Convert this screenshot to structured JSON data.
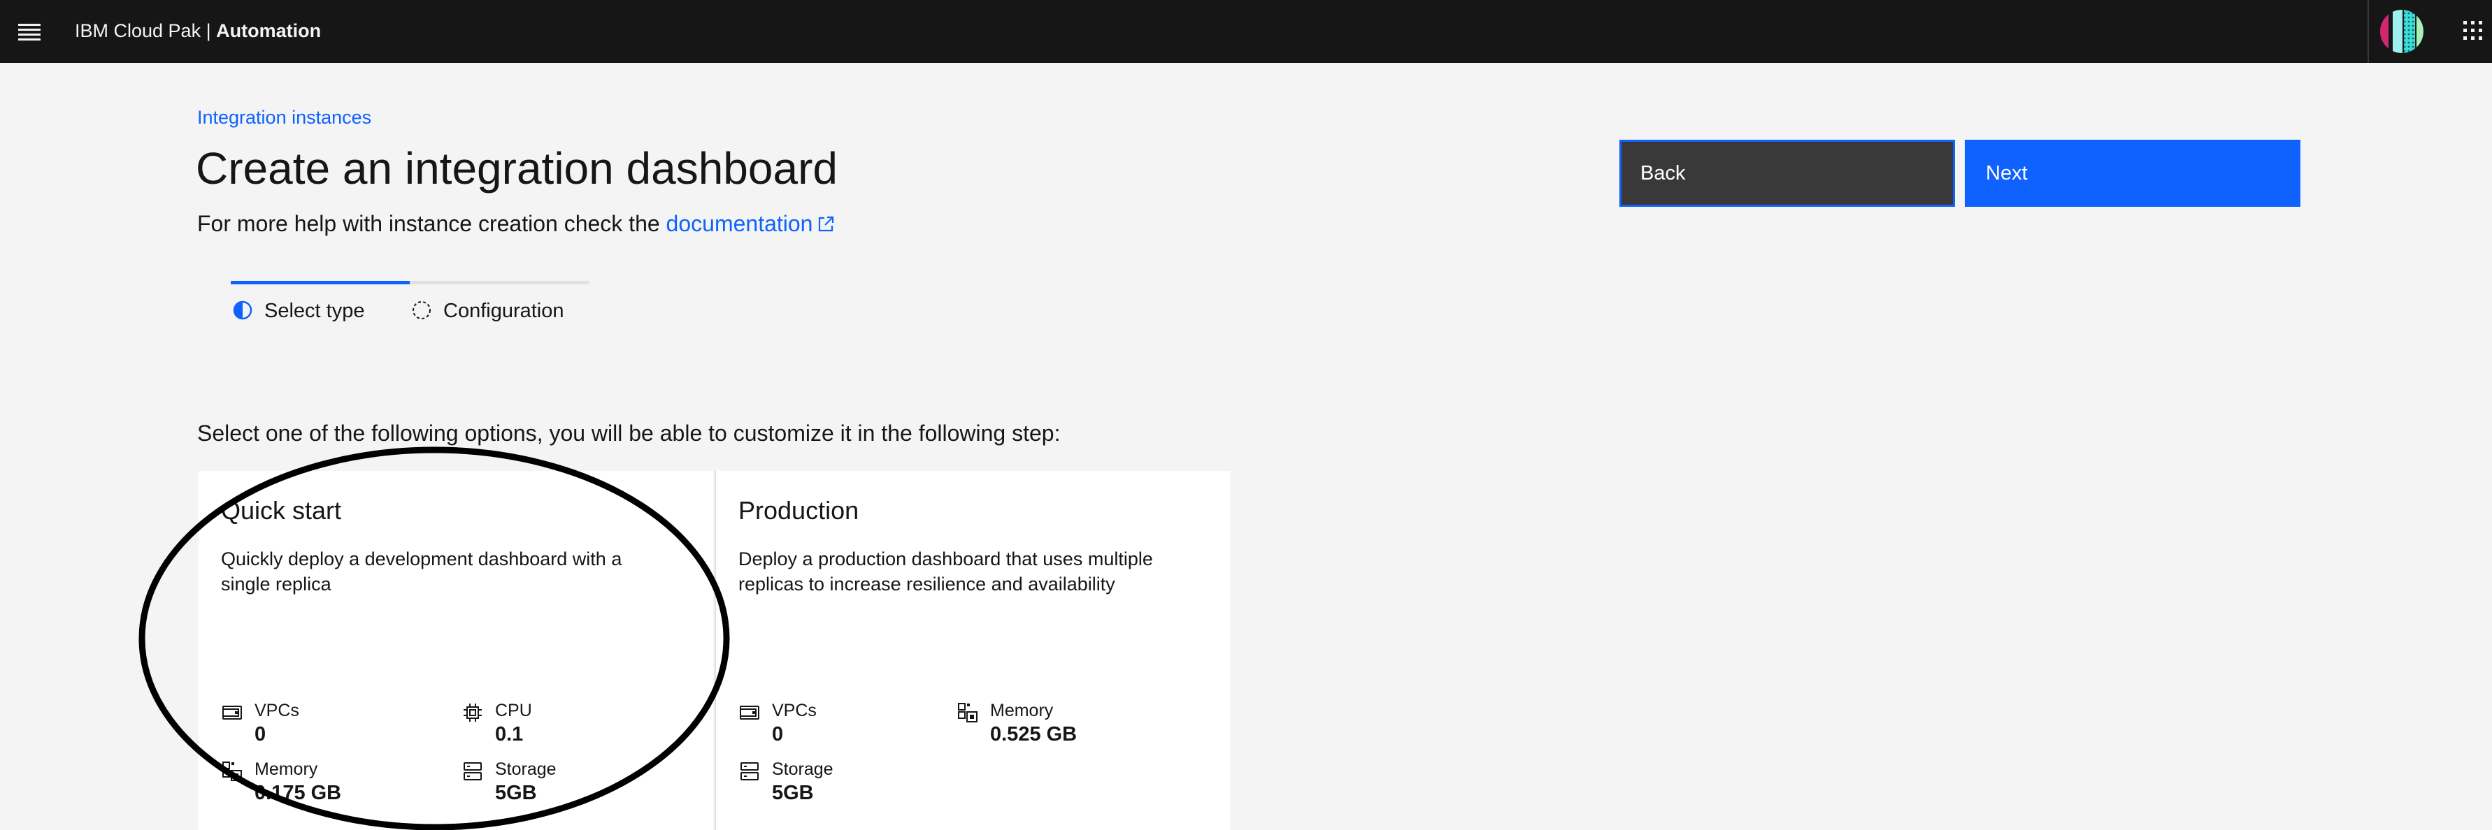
{
  "header": {
    "brand_prefix": "IBM Cloud Pak | ",
    "brand_product": "Automation",
    "menu_icon": "hamburger-menu-icon",
    "switcher_icon": "app-switcher-grid-icon",
    "avatar_icon": "user-avatar"
  },
  "breadcrumb": {
    "link": "Integration instances"
  },
  "page": {
    "title": "Create an integration dashboard",
    "help_text": "For more help with instance creation check the ",
    "help_link": "documentation",
    "help_link_icon": "launch-external-icon"
  },
  "actions": {
    "back": "Back",
    "next": "Next"
  },
  "progress": {
    "steps": [
      {
        "label": "Select type",
        "state": "current",
        "icon": "half-filled-circle-icon"
      },
      {
        "label": "Configuration",
        "state": "incomplete",
        "icon": "dashed-circle-icon"
      }
    ]
  },
  "options": {
    "instruction": "Select one of the following options, you will be able to customize it in the following step:",
    "tiles": [
      {
        "title": "Quick start",
        "description": "Quickly deploy a development dashboard with a single replica",
        "specs": [
          {
            "label": "VPCs",
            "value": "0",
            "icon": "vpc-icon"
          },
          {
            "label": "CPU",
            "value": "0.1",
            "icon": "chip-icon"
          },
          {
            "label": "Memory",
            "value": "0.175 GB",
            "icon": "memory-icon"
          },
          {
            "label": "Storage",
            "value": "5GB",
            "icon": "storage-icon"
          }
        ]
      },
      {
        "title": "Production",
        "description": "Deploy a production dashboard that uses multiple replicas to increase resilience and availability",
        "specs": [
          {
            "label": "VPCs",
            "value": "0",
            "icon": "vpc-icon"
          },
          {
            "label": "Memory",
            "value": "0.525 GB",
            "icon": "memory-icon"
          },
          {
            "label": "Storage",
            "value": "5GB",
            "icon": "storage-icon"
          }
        ]
      }
    ]
  },
  "colors": {
    "header_bg": "#161616",
    "page_bg": "#f4f4f4",
    "primary": "#0f62fe",
    "secondary_button": "#393939",
    "tile_bg": "#ffffff"
  }
}
